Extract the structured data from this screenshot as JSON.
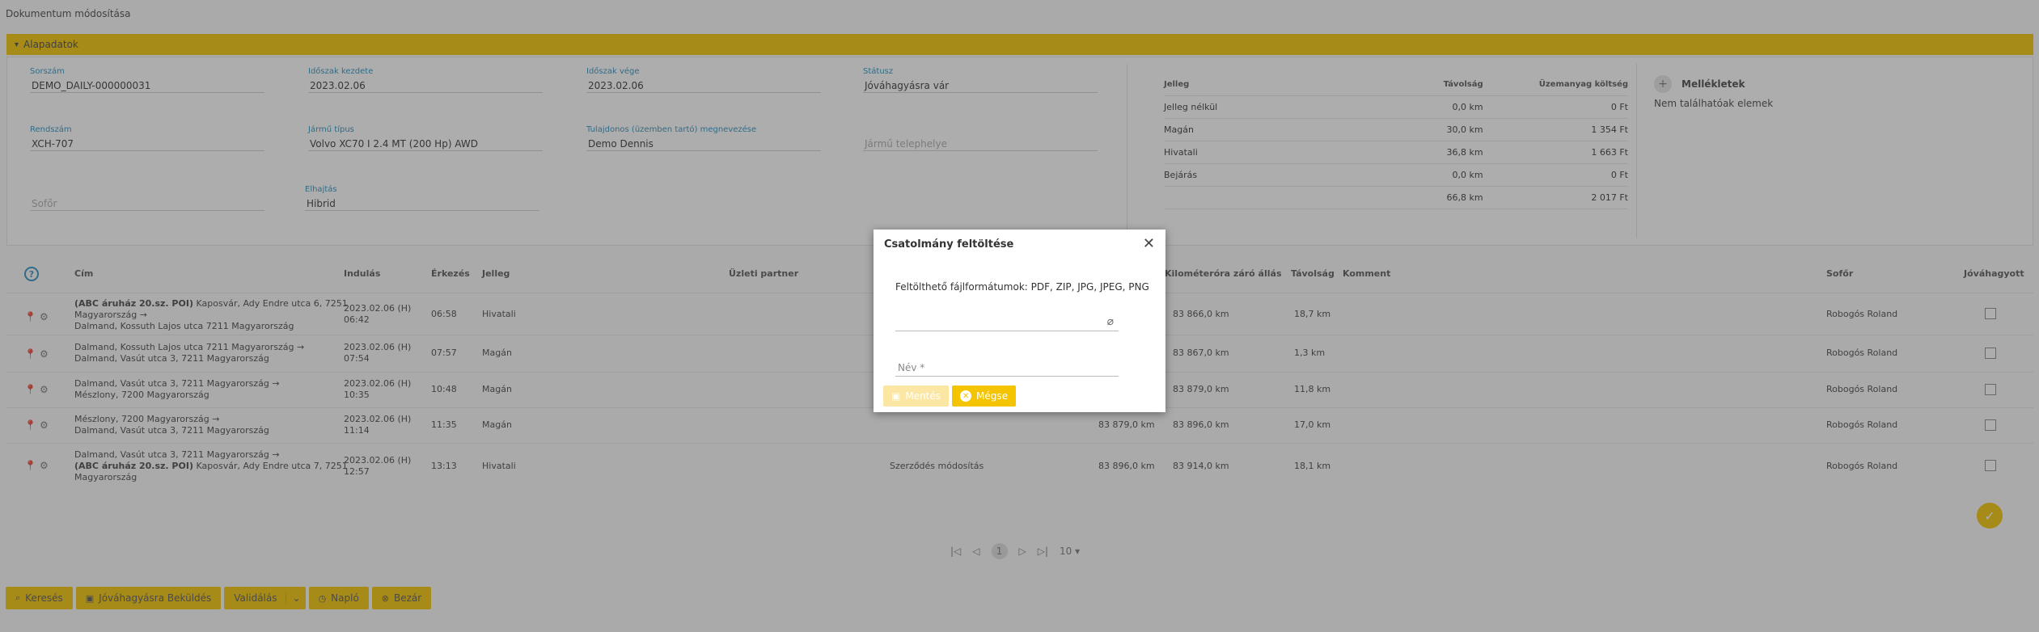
{
  "page_title": "Dokumentum módosítása",
  "section": {
    "label": "Alapadatok"
  },
  "fields": {
    "sorszam": {
      "label": "Sorszám",
      "value": "DEMO_DAILY-000000031"
    },
    "idoszak_kezdete": {
      "label": "Időszak kezdete",
      "value": "2023.02.06"
    },
    "idoszak_vege": {
      "label": "Időszak vége",
      "value": "2023.02.06"
    },
    "statusz": {
      "label": "Státusz",
      "value": "Jóváhagyásra vár"
    },
    "rendszam": {
      "label": "Rendszám",
      "value": "XCH-707"
    },
    "jarmu_tipus": {
      "label": "Jármű típus",
      "value": "Volvo XC70 I 2.4 MT (200 Hp) AWD"
    },
    "tulajdonos": {
      "label": "Tulajdonos (üzemben tartó) megnevezése",
      "value": "Demo Dennis"
    },
    "telephely": {
      "placeholder": "Jármű telephelye"
    },
    "sofor": {
      "placeholder": "Sofőr"
    },
    "elhajtas": {
      "label": "Elhajtás",
      "value": "Hibrid"
    }
  },
  "summary": {
    "headers": [
      "Jelleg",
      "Távolság",
      "Üzemanyag költség"
    ],
    "rows": [
      [
        "Jelleg nélkül",
        "0,0 km",
        "0 Ft"
      ],
      [
        "Magán",
        "30,0 km",
        "1 354 Ft"
      ],
      [
        "Hivatali",
        "36,8 km",
        "1 663 Ft"
      ],
      [
        "Bejárás",
        "0,0 km",
        "0 Ft"
      ],
      [
        "",
        "66,8 km",
        "2 017 Ft"
      ]
    ]
  },
  "attachments": {
    "title": "Mellékletek",
    "empty": "Nem találhatóak elemek"
  },
  "table": {
    "headers": {
      "cim": "Cím",
      "indulas": "Indulás",
      "erkezes": "Érkezés",
      "jelleg": "Jelleg",
      "partner": "Üzleti partner",
      "km_zaro": "Kilométeróra záró állás",
      "tavolsag": "Távolság",
      "komment": "Komment",
      "sofor": "Sofőr",
      "jovahagyott": "Jóváhagyott"
    },
    "rows": [
      {
        "cim_bold": "(ABC áruház 20.sz. POI)",
        "cim_line1": "Kaposvár, Ady Endre utca 6, 7251",
        "cim_line2": "Magyarország →",
        "cim_line3": "Dalmand, Kossuth Lajos utca 7211 Magyarország",
        "indulas": "2023.02.06 (H)",
        "indulas2": "06:42",
        "erkezes": "06:58",
        "jelleg": "Hivatali",
        "partner": "",
        "km_start": "",
        "km_zaro": "83 866,0 km",
        "tavolsag": "18,7 km",
        "sofor": "Robogós Roland"
      },
      {
        "cim_bold": "",
        "cim_line1": "Dalmand, Kossuth Lajos utca 7211 Magyarország →",
        "cim_line2": "Dalmand, Vasút utca 3, 7211 Magyarország",
        "cim_line3": "",
        "indulas": "2023.02.06 (H)",
        "indulas2": "07:54",
        "erkezes": "07:57",
        "jelleg": "Magán",
        "partner": "",
        "km_start": "",
        "km_zaro": "83 867,0 km",
        "tavolsag": "1,3 km",
        "sofor": "Robogós Roland"
      },
      {
        "cim_bold": "",
        "cim_line1": "Dalmand, Vasút utca 3, 7211 Magyarország →",
        "cim_line2": "Mészlony, 7200 Magyarország",
        "cim_line3": "",
        "indulas": "2023.02.06 (H)",
        "indulas2": "10:35",
        "erkezes": "10:48",
        "jelleg": "Magán",
        "partner": "",
        "km_start": "",
        "km_zaro": "83 879,0 km",
        "tavolsag": "11,8 km",
        "sofor": "Robogós Roland"
      },
      {
        "cim_bold": "",
        "cim_line1": "Mészlony, 7200 Magyarország →",
        "cim_line2": "Dalmand, Vasút utca 3, 7211 Magyarország",
        "cim_line3": "",
        "indulas": "2023.02.06 (H)",
        "indulas2": "11:14",
        "erkezes": "11:35",
        "jelleg": "Magán",
        "partner": "",
        "km_start": "83 879,0 km",
        "km_zaro": "83 896,0 km",
        "tavolsag": "17,0 km",
        "sofor": "Robogós Roland"
      },
      {
        "cim_bold": "(ABC áruház 20.sz. POI)",
        "cim_line1": "Dalmand, Vasút utca 3, 7211 Magyarország →",
        "cim_line2": "Kaposvár, Ady Endre utca 7, 7251",
        "cim_line3": "Magyarország",
        "indulas": "2023.02.06 (H)",
        "indulas2": "12:57",
        "erkezes": "13:13",
        "jelleg": "Hivatali",
        "partner": "Szerződés módosítás",
        "km_start": "83 896,0 km",
        "km_zaro": "83 914,0 km",
        "tavolsag": "18,1 km",
        "sofor": "Robogós Roland"
      }
    ]
  },
  "pager": {
    "current": "1",
    "page_size": "10"
  },
  "bottom_buttons": {
    "search": "Keresés",
    "save_submit": "Jóváhagyásra Beküldés",
    "validate": "Validálás",
    "history": "Napló",
    "close": "Bezár"
  },
  "modal": {
    "title": "Csatolmány feltöltése",
    "formats": "Feltölthető fájlformátumok: PDF, ZIP, JPG, JPEG, PNG",
    "name_placeholder": "Név *",
    "save_label": "Mentés",
    "cancel_label": "Mégse"
  }
}
